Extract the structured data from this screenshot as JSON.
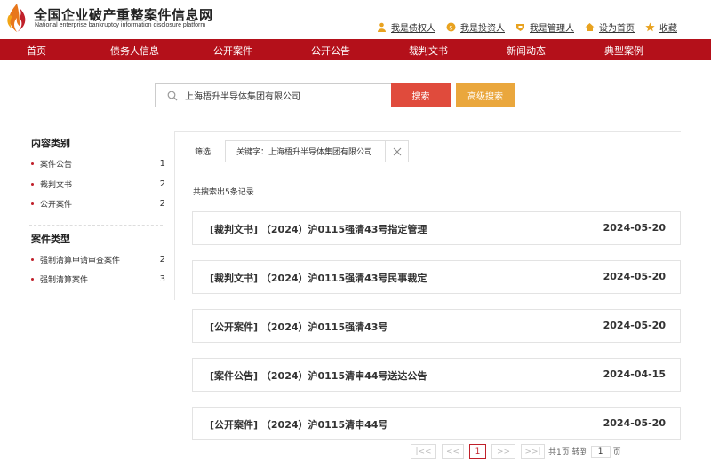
{
  "brand": {
    "title": "全国企业破产重整案件信息网",
    "subtitle": "National enterprise bankruptcy information disclosure platform"
  },
  "top_links": [
    {
      "label": "我是债权人",
      "icon": "person-icon"
    },
    {
      "label": "我是投资人",
      "icon": "investor-icon"
    },
    {
      "label": "我是管理人",
      "icon": "manager-icon"
    },
    {
      "label": "设为首页",
      "icon": "home-icon"
    },
    {
      "label": "收藏",
      "icon": "star-icon"
    }
  ],
  "nav": [
    "首页",
    "债务人信息",
    "公开案件",
    "公开公告",
    "裁判文书",
    "新闻动态",
    "典型案例"
  ],
  "search": {
    "value": "上海梧升半导体集团有限公司",
    "button": "搜索",
    "advanced": "高级搜索"
  },
  "sidebar": {
    "content_heading": "内容类别",
    "content_items": [
      {
        "label": "案件公告",
        "count": "1"
      },
      {
        "label": "裁判文书",
        "count": "2"
      },
      {
        "label": "公开案件",
        "count": "2"
      }
    ],
    "type_heading": "案件类型",
    "type_items": [
      {
        "label": "强制清算申请审查案件",
        "count": "2"
      },
      {
        "label": "强制清算案件",
        "count": "3"
      }
    ]
  },
  "filter": {
    "label": "筛选",
    "keyword": "关键字：上海梧升半导体集团有限公司"
  },
  "result_count": "共搜索出5条记录",
  "results": [
    {
      "title": "[裁判文书] （2024）沪0115强清43号指定管理",
      "date": "2024-05-20"
    },
    {
      "title": "[裁判文书] （2024）沪0115强清43号民事裁定",
      "date": "2024-05-20"
    },
    {
      "title": "[公开案件] （2024）沪0115强清43号",
      "date": "2024-05-20"
    },
    {
      "title": "[案件公告] （2024）沪0115清申44号送达公告",
      "date": "2024-04-15"
    },
    {
      "title": "[公开案件] （2024）沪0115清申44号",
      "date": "2024-05-20"
    }
  ],
  "pager": {
    "first": "|<<",
    "prev": "<<",
    "current": "1",
    "next": ">>",
    "last": ">>|",
    "total_text": "共1页 转到",
    "goto_value": "1",
    "page_unit": "页"
  },
  "colors": {
    "nav_bg": "#b4101a",
    "search_btn": "#e04b3c",
    "adv_btn": "#eaa73d"
  }
}
